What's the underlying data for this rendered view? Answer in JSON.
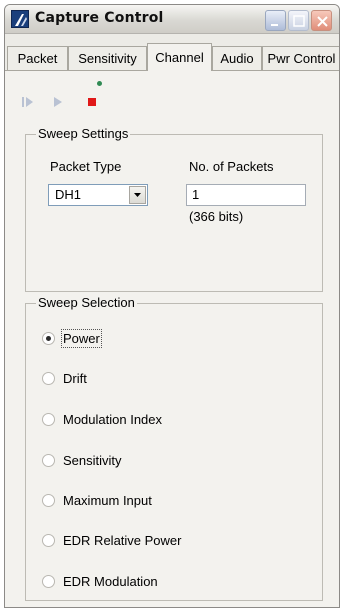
{
  "window": {
    "title": "Capture Control"
  },
  "tabs": [
    {
      "label": "Packet"
    },
    {
      "label": "Sensitivity"
    },
    {
      "label": "Channel"
    },
    {
      "label": "Audio"
    },
    {
      "label": "Pwr Control"
    }
  ],
  "active_tab": "Channel",
  "toolbar": {
    "buttons": [
      "step-forward-icon",
      "play-icon",
      "stop-icon"
    ],
    "status_led_color": "#2f8a53"
  },
  "sweep_settings": {
    "group_label": "Sweep Settings",
    "packet_type_label": "Packet Type",
    "packet_type_value": "DH1",
    "packets_label": "No. of Packets",
    "packets_value": "1",
    "bits_note": "(366 bits)"
  },
  "sweep_selection": {
    "group_label": "Sweep Selection",
    "selected": "Power",
    "options": [
      {
        "label": "Power"
      },
      {
        "label": "Drift"
      },
      {
        "label": "Modulation Index"
      },
      {
        "label": "Sensitivity"
      },
      {
        "label": "Maximum Input"
      },
      {
        "label": "EDR Relative Power"
      },
      {
        "label": "EDR Modulation"
      }
    ]
  }
}
